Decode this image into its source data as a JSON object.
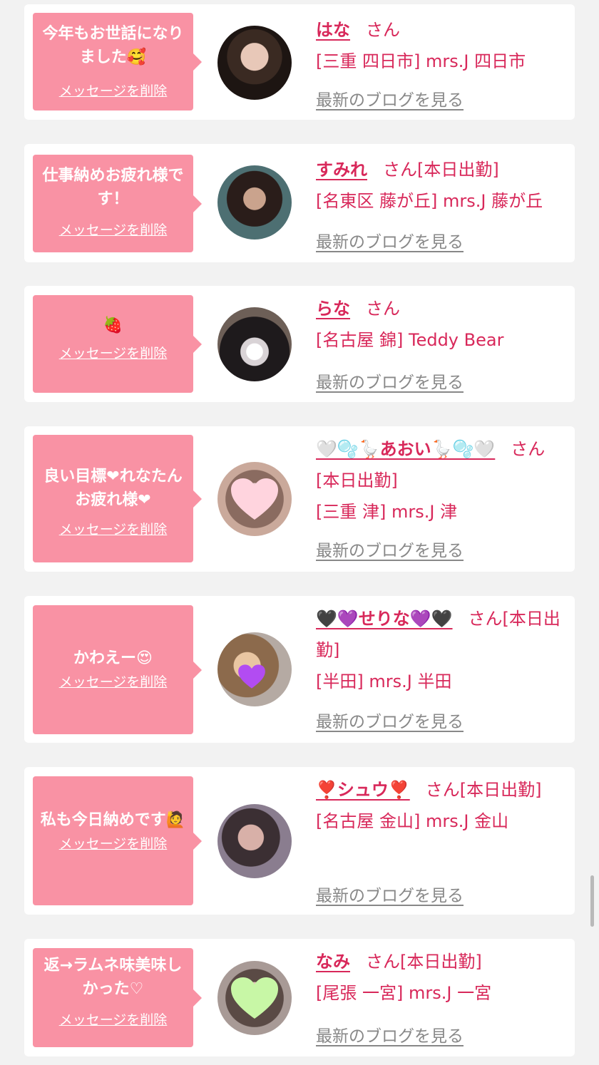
{
  "cards": [
    {
      "message": "今年もお世話になりました🥰",
      "delete_label": "メッセージを削除",
      "name": "はな",
      "honorific": "さん",
      "status": "",
      "area": "[三重 四日市] mrs.J 四日市",
      "blog_link": "最新のブログを見る"
    },
    {
      "message": "仕事納めお疲れ様です！",
      "delete_label": "メッセージを削除",
      "name": "すみれ",
      "honorific": "さん",
      "status": "[本日出勤]",
      "area": "[名東区 藤が丘] mrs.J 藤が丘",
      "blog_link": "最新のブログを見る"
    },
    {
      "message": "🍓",
      "delete_label": "メッセージを削除",
      "name": "らな",
      "honorific": "さん",
      "status": "",
      "area": "[名古屋 錦] Teddy Bear",
      "blog_link": "最新のブログを見る"
    },
    {
      "message": "良い目標❤れなたんお疲れ様❤",
      "delete_label": "メッセージを削除",
      "name": "🤍🫧🪿あおい🪿🫧🤍",
      "honorific": "さん",
      "status": "[本日出勤]",
      "area": "[三重 津] mrs.J 津",
      "blog_link": "最新のブログを見る"
    },
    {
      "message": "かわえー😍",
      "delete_label": "メッセージを削除",
      "name": "🖤💜せりな💜🖤",
      "honorific": "さん",
      "status": "[本日出勤]",
      "area": "[半田] mrs.J 半田",
      "blog_link": "最新のブログを見る"
    },
    {
      "message": "私も今日納めです🙋",
      "delete_label": "メッセージを削除",
      "name": "❣️シュウ❣️",
      "honorific": "さん",
      "status": "[本日出勤]",
      "area": "[名古屋 金山] mrs.J 金山",
      "blog_link": "最新のブログを見る"
    },
    {
      "message": "返→ラムネ味美味しかった♡",
      "delete_label": "メッセージを削除",
      "name": "なみ",
      "honorific": "さん",
      "status": "[本日出勤]",
      "area": "[尾張 一宮] mrs.J 一宮",
      "blog_link": "最新のブログを見る"
    }
  ],
  "colors": {
    "accent": "#d8285a",
    "bubble": "#f992a4",
    "background": "#f2f2f2"
  }
}
